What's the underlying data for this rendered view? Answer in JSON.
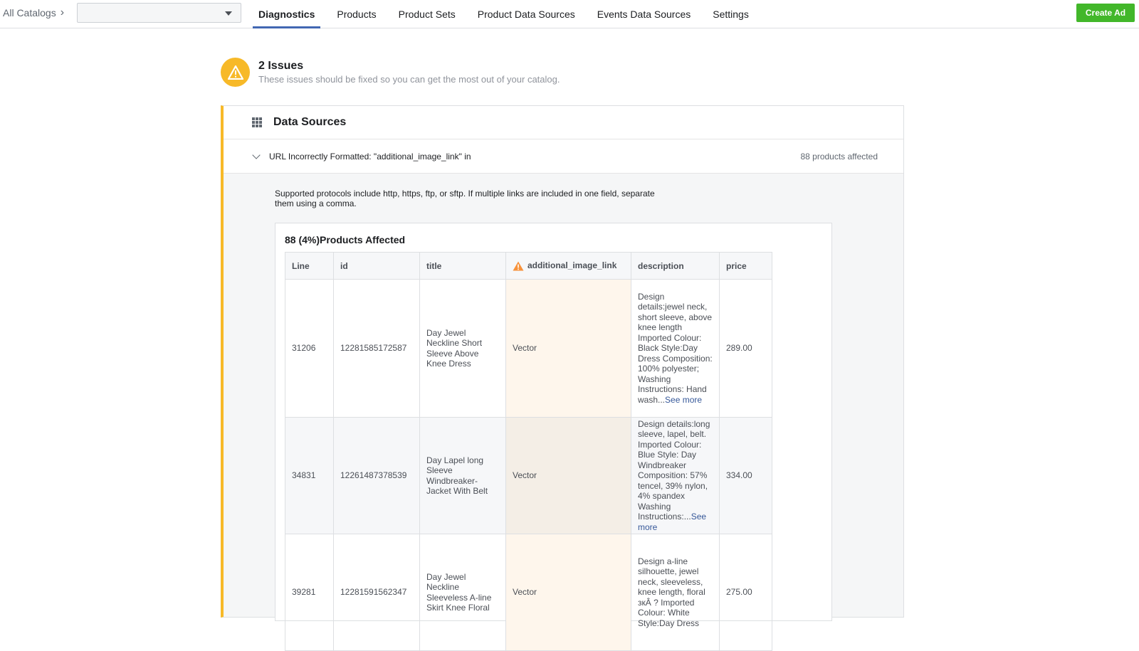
{
  "topbar": {
    "breadcrumb": "All Catalogs",
    "catalog_select_value": "",
    "tabs": [
      {
        "label": "Diagnostics",
        "active": true
      },
      {
        "label": "Products",
        "active": false
      },
      {
        "label": "Product Sets",
        "active": false
      },
      {
        "label": "Product Data Sources",
        "active": false
      },
      {
        "label": "Events Data Sources",
        "active": false
      },
      {
        "label": "Settings",
        "active": false
      }
    ],
    "create_ad_label": "Create Ad"
  },
  "issues": {
    "title": "2 Issues",
    "subtitle": "These issues should be fixed so you can get the most out of your catalog."
  },
  "panel": {
    "title": "Data Sources",
    "issue_title": "URL Incorrectly Formatted: \"additional_image_link\" in",
    "affected": "88 products affected",
    "description": "Supported protocols include http, https, ftp, or sftp. If multiple links are included in one field, separate them using a comma.",
    "card_title": "88 (4%)Products Affected",
    "columns": [
      "Line",
      "id",
      "title",
      "additional_image_link",
      "description",
      "price"
    ],
    "see_more": "See more",
    "rows": [
      {
        "line": "31206",
        "id": "12281585172587",
        "title": "Day Jewel Neckline Short Sleeve Above Knee Dress",
        "additional_image_link": "Vector",
        "description": "Design details:jewel neck, short sleeve, above knee length Imported Colour: Black Style:Day Dress Composition: 100% polyester; Washing Instructions: Hand wash...",
        "price": "289.00"
      },
      {
        "line": "34831",
        "id": "12261487378539",
        "title": "Day Lapel long Sleeve Windbreaker-Jacket With Belt",
        "additional_image_link": "Vector",
        "description": "Design details:long sleeve, lapel, belt. Imported Colour: Blue Style: Day Windbreaker Composition: 57% tencel, 39% nylon, 4% spandex Washing Instructions:...",
        "price": "334.00"
      },
      {
        "line": "39281",
        "id": "12281591562347",
        "title": "Day Jewel Neckline Sleeveless A-line Skirt Knee Floral",
        "additional_image_link": "Vector",
        "description": "Design a-line silhouette, jewel neck, sleeveless, knee length, floral зкÂ ? Imported Colour: White Style:Day Dress",
        "price": "275.00"
      }
    ]
  },
  "colors": {
    "accent": "#4267b2",
    "create_ad": "#42b72a",
    "warning": "#f7b928",
    "highlight_column": "#fef6ec"
  },
  "icons": [
    "chevron-right-icon",
    "caret-down-icon",
    "warning-icon",
    "grid-icon",
    "chevron-down-icon"
  ]
}
